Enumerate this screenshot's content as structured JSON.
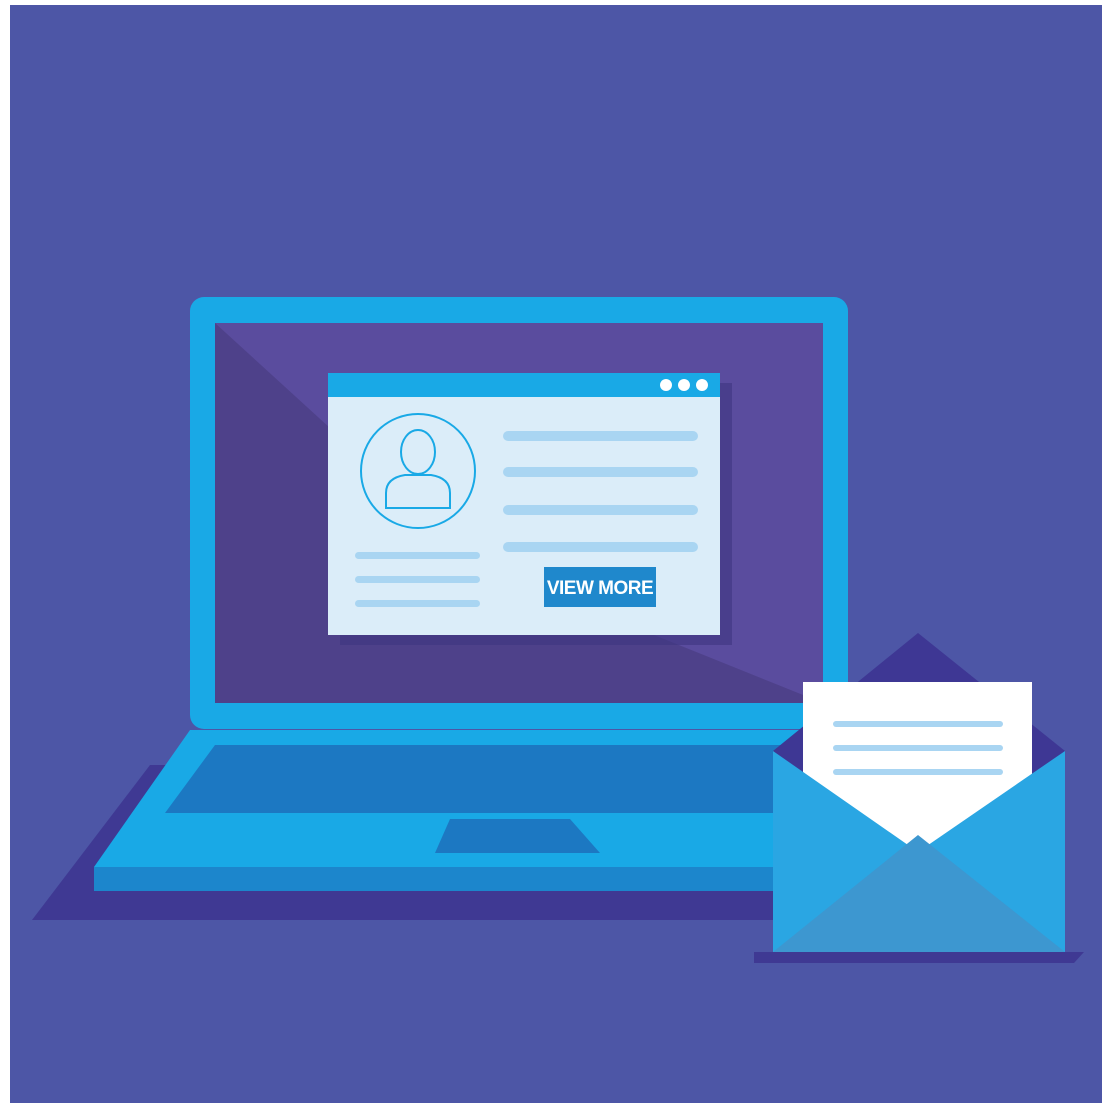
{
  "scene": {
    "description_icons": [
      "laptop-icon",
      "browser-window-icon",
      "user-avatar-icon",
      "envelope-icon",
      "letter-icon"
    ],
    "colors": {
      "background": "#4d56a6",
      "laptop_body": "#19a9e6",
      "laptop_dark": "#1c78c2",
      "screen": "#5a4c9e",
      "screen_shadow": "#4c3f86",
      "window_bg": "#dbedf9",
      "window_bar": "#19a9e6",
      "placeholder_line": "#a9d5f2",
      "button": "#1f88cc",
      "envelope_front": "#2aa6e3",
      "envelope_inner": "#3d97d0",
      "letter": "#ffffff",
      "ground_shadow": "#3f3993"
    }
  },
  "profile_window": {
    "button_label": "VIEW MORE"
  }
}
